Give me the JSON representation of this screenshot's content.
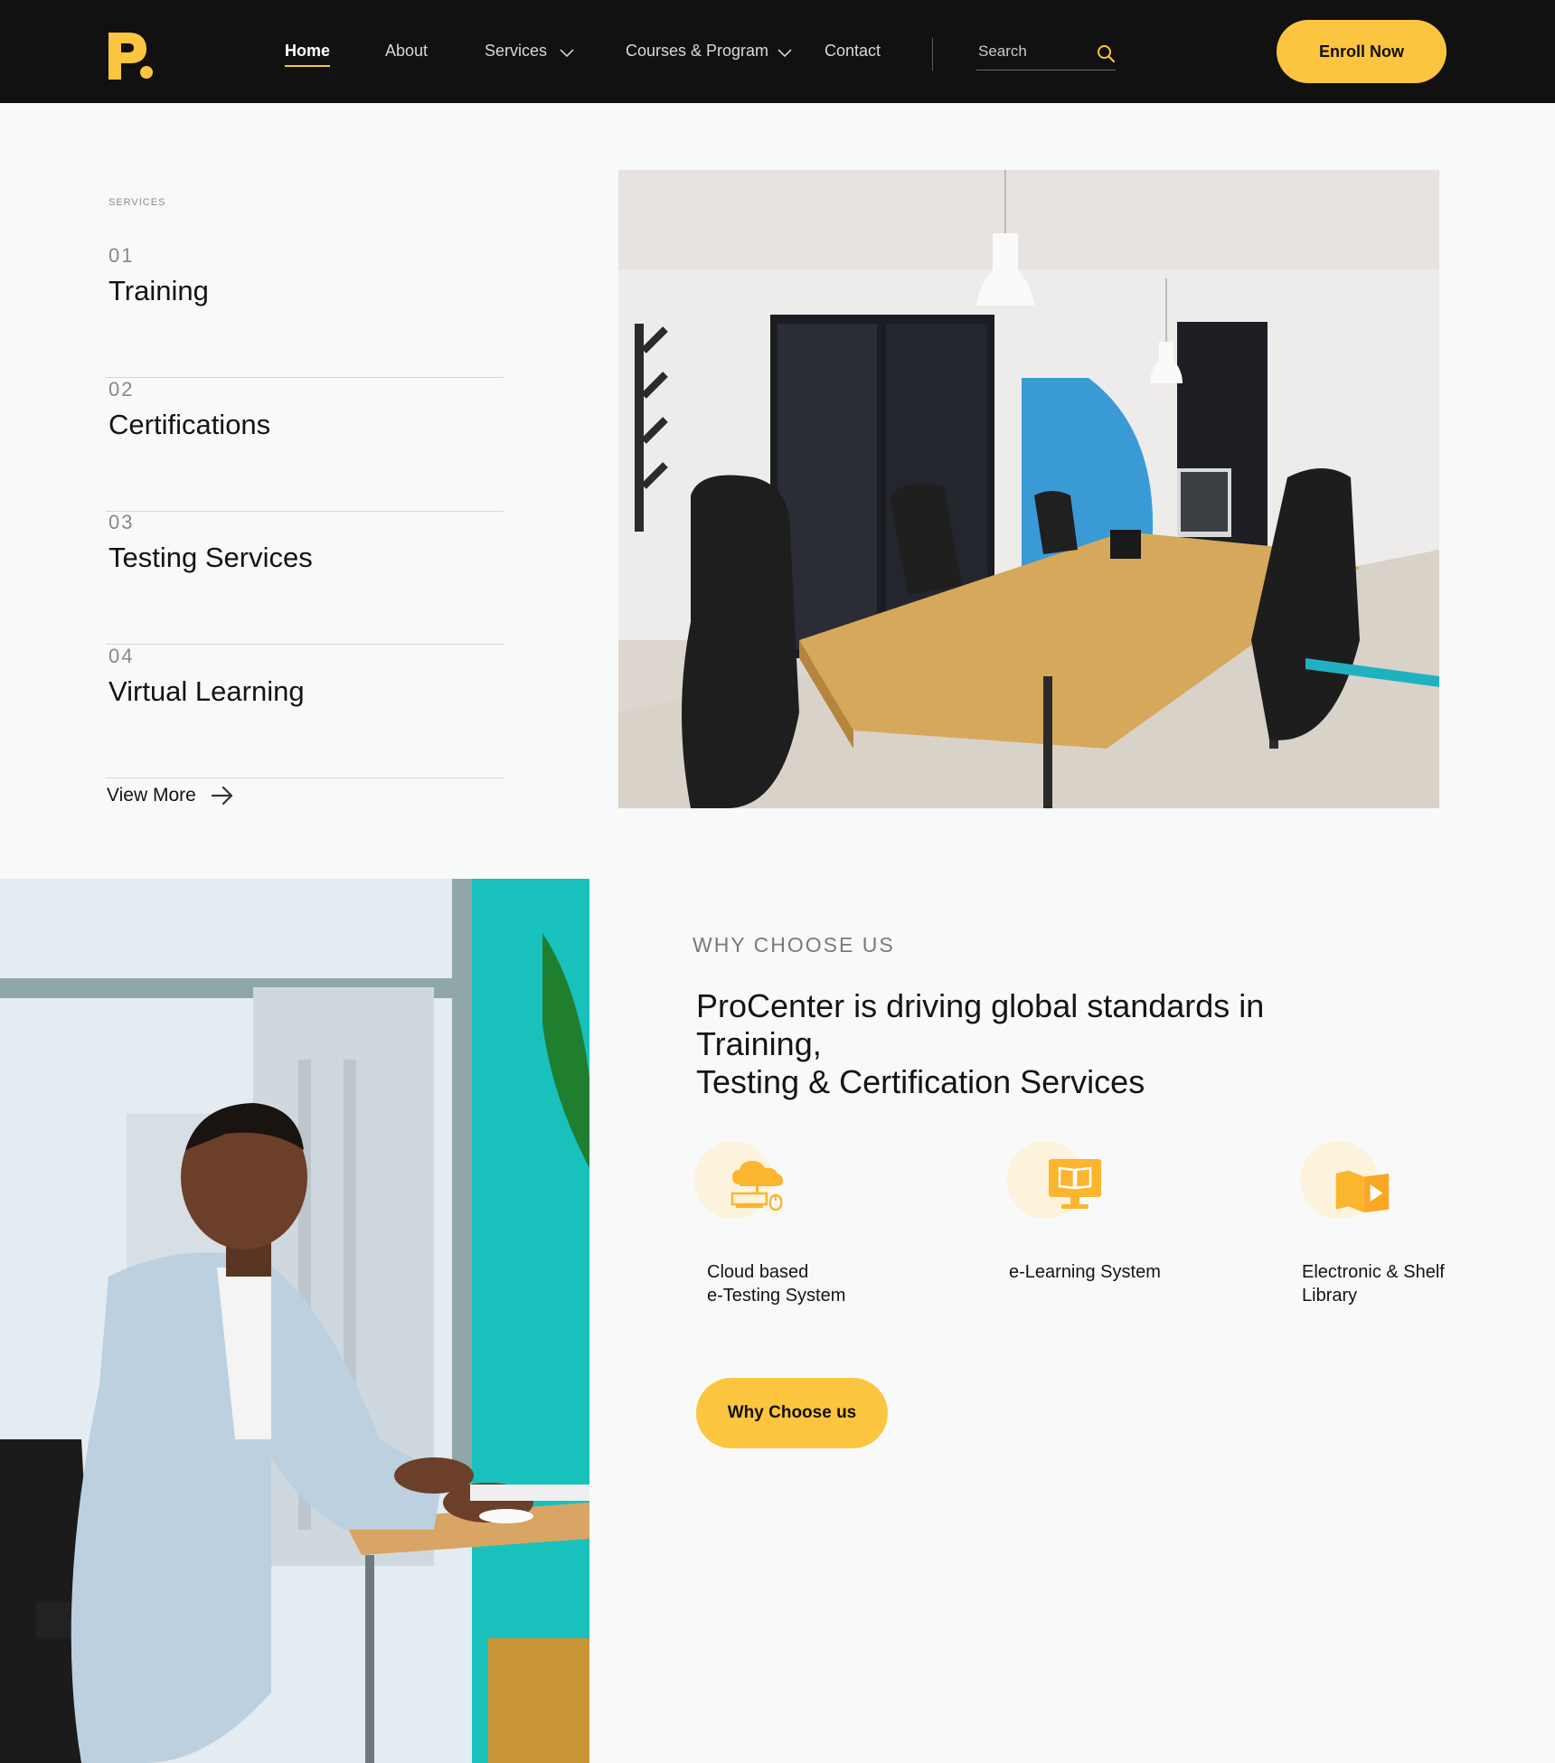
{
  "nav": {
    "home": "Home",
    "about": "About",
    "services": "Services",
    "courses": "Courses & Program",
    "contact": "Contact",
    "search_placeholder": "Search",
    "enroll": "Enroll Now"
  },
  "services": {
    "eyebrow": "SERVICES",
    "items": [
      {
        "num": "01",
        "title": "Training"
      },
      {
        "num": "02",
        "title": "Certifications"
      },
      {
        "num": "03",
        "title": "Testing Services"
      },
      {
        "num": "04",
        "title": "Virtual Learning"
      }
    ],
    "view_more": "View More"
  },
  "why": {
    "eyebrow": "WHY CHOOSE US",
    "heading_line1": "ProCenter is driving global standards in Training,",
    "heading_line2": "Testing & Certification Services",
    "features": [
      {
        "line1": "Cloud based",
        "line2": "e-Testing System",
        "icon": "cloud-testing-icon"
      },
      {
        "line1": "e-Learning System",
        "line2": "",
        "icon": "elearning-monitor-icon"
      },
      {
        "line1": "Electronic & Shelf",
        "line2": "Library",
        "icon": "library-book-icon"
      }
    ],
    "button": "Why Choose us"
  },
  "colors": {
    "accent": "#fcc53f",
    "header_bg": "#111111",
    "page_bg": "#f8f9f9"
  }
}
